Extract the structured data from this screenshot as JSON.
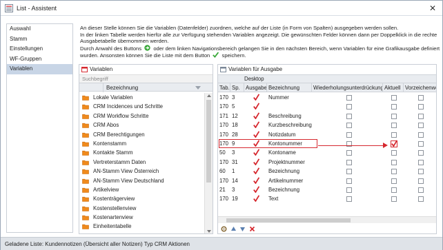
{
  "window": {
    "title": "List - Assistent",
    "close": "✕"
  },
  "nav": {
    "items": [
      "Auswahl",
      "Stamm",
      "Einstellungen",
      "WF-Gruppen",
      "Variablen"
    ],
    "active_index": 4
  },
  "intro": {
    "line1": "An dieser Stelle können Sie die Variablen (Datenfelder) zuordnen, welche auf der Liste (in Form von Spalten) ausgegeben werden sollen.",
    "line2": "In der linken Tabelle werden hierfür alle zur Verfügung stehenden Variablen angezeigt. Die gewünschten Felder können dann per Doppelklick in die rechte",
    "line3": "Ausgabetabelle übernommen werden.",
    "line4a": "Durch Anwahl des Buttons",
    "line4b": "oder dem linken Navigationsbereich gelangen Sie in den nächsten Bereich, wenn Variablen für eine Grafikausgabe definiert",
    "line5a": "wurden. Ansonsten können Sie die Liste mit dem Button",
    "line5b": "speichern."
  },
  "variables_panel": {
    "title": "Variablen",
    "search_placeholder": "Suchbegriff",
    "column": "Bezeichnung",
    "items": [
      "Lokale Variablen",
      "CRM Incidences und Schritte",
      "CRM Workflow Schritte",
      "CRM Abos",
      "CRM Berechtigungen",
      "Kontenstamm",
      "Kontakte Stamm",
      "Vertreterstamm Daten",
      "AN-Stamm View Österreich",
      "AN-Stamm View Deutschland",
      "Artikelview",
      "Kostenträgerview",
      "Kostenstellenview",
      "Kostenartenview",
      "Einheitentabelle"
    ]
  },
  "output_panel": {
    "title": "Variablen für Ausgabe",
    "group": "Desktop",
    "columns": [
      "Tab.",
      "Sp.",
      "Ausgabe",
      "Bezeichnung",
      "Wiederholungsunterdrückung",
      "Aktuell",
      "Vorzeichenwe"
    ],
    "rows": [
      {
        "tab": "170",
        "sp": "3",
        "label": "Nummer"
      },
      {
        "tab": "170",
        "sp": "5",
        "label": ""
      },
      {
        "tab": "171",
        "sp": "12",
        "label": "Beschreibung"
      },
      {
        "tab": "170",
        "sp": "18",
        "label": "Kurzbeschreibung"
      },
      {
        "tab": "170",
        "sp": "28",
        "label": "Notizdatum"
      },
      {
        "tab": "170",
        "sp": "9",
        "label": "Kontonummer"
      },
      {
        "tab": "50",
        "sp": "3",
        "label": "Kontoname"
      },
      {
        "tab": "170",
        "sp": "31",
        "label": "Projektnummer"
      },
      {
        "tab": "60",
        "sp": "1",
        "label": "Bezeichnung"
      },
      {
        "tab": "170",
        "sp": "14",
        "label": "Artikelnummer"
      },
      {
        "tab": "21",
        "sp": "3",
        "label": "Bezeichnung"
      },
      {
        "tab": "170",
        "sp": "19",
        "label": "Text"
      }
    ],
    "highlighted_row": 5
  },
  "status": {
    "text": "Geladene Liste: Kundennotizen (Übersicht aller Notizen) Typ CRM Aktionen"
  },
  "colors": {
    "accent_red": "#d6272e",
    "folder_orange": "#f08a1c",
    "nav_active": "#c8d5e6"
  },
  "icons": {
    "app": "list-app-icon",
    "next": "green-arrow-icon",
    "save": "green-check-icon",
    "folder": "folder-icon"
  }
}
